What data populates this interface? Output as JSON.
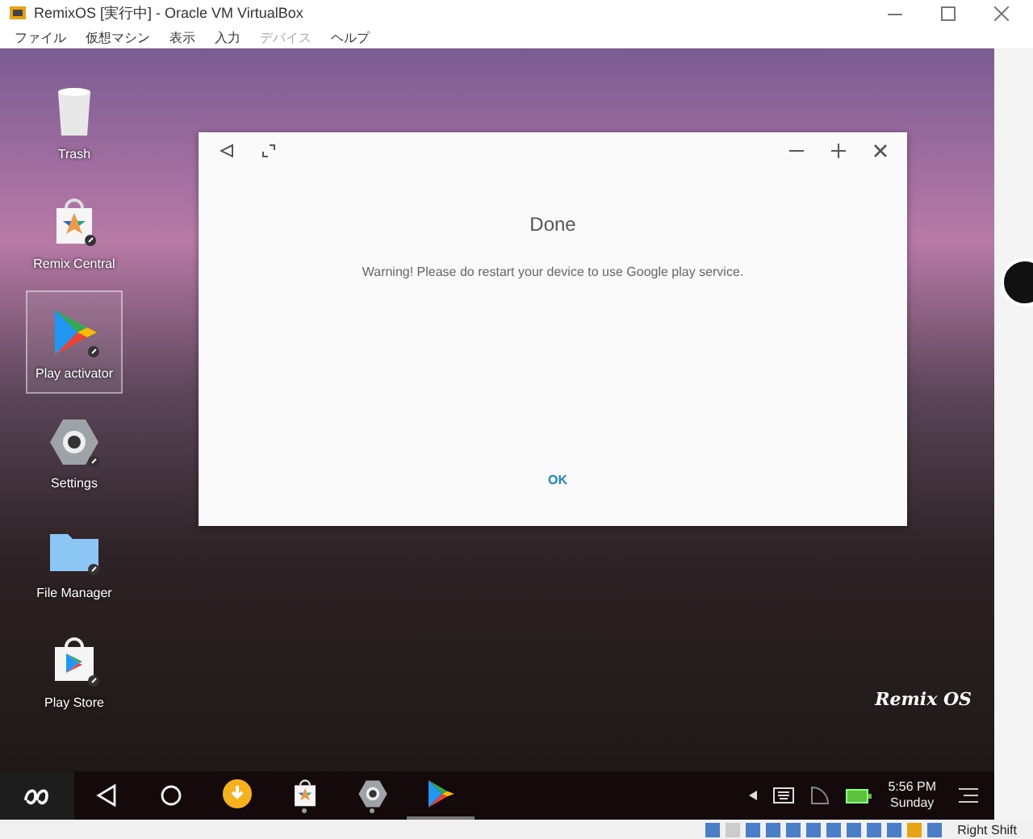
{
  "window": {
    "title": "RemixOS [実行中] - Oracle VM VirtualBox"
  },
  "menu": [
    {
      "label": "ファイル",
      "disabled": false
    },
    {
      "label": "仮想マシン",
      "disabled": false
    },
    {
      "label": "表示",
      "disabled": false
    },
    {
      "label": "入力",
      "disabled": false
    },
    {
      "label": "デバイス",
      "disabled": true
    },
    {
      "label": "ヘルプ",
      "disabled": false
    }
  ],
  "desktop_icons": [
    {
      "kind": "trash",
      "label": "Trash",
      "selected": false
    },
    {
      "kind": "store-star",
      "label": "Remix Central",
      "selected": false
    },
    {
      "kind": "play",
      "label": "Play activator",
      "selected": true
    },
    {
      "kind": "settings",
      "label": "Settings",
      "selected": false
    },
    {
      "kind": "folder",
      "label": "File Manager",
      "selected": false
    },
    {
      "kind": "play-store",
      "label": "Play Store",
      "selected": false
    }
  ],
  "dialog": {
    "title": "Done",
    "message": "Warning! Please do restart your device to use Google play service.",
    "button": "OK"
  },
  "wallpaper_logo": "Remix OS",
  "taskbar": {
    "apps": [
      {
        "kind": "download",
        "selected": false,
        "running": false
      },
      {
        "kind": "store-star",
        "selected": false,
        "running": true
      },
      {
        "kind": "settings",
        "selected": false,
        "running": true
      },
      {
        "kind": "play",
        "selected": true,
        "running": false
      }
    ],
    "time": "5:56 PM",
    "day": "Sunday"
  },
  "status_bar": {
    "host_key": "Right Shift"
  }
}
